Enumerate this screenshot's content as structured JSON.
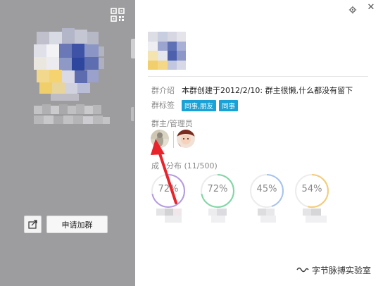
{
  "left_panel": {
    "apply_label": "申请加群"
  },
  "info": {
    "intro_label": "群介绍",
    "intro_text": "本群创建于2012/2/10:  群主很懒,什么都没有留下",
    "tags_label": "群标签",
    "tags": [
      "同事,朋友",
      "同事"
    ]
  },
  "admins": {
    "title": "群主/管理员"
  },
  "members": {
    "title_prefix": "成",
    "title_suffix": "分布",
    "title_count": "(11/500)",
    "stats": [
      {
        "label": "72%",
        "percent": 72,
        "color": "#b49be0"
      },
      {
        "label": "72%",
        "percent": 72,
        "color": "#7fd6a4"
      },
      {
        "label": "45%",
        "percent": 45,
        "color": "#a6c3ef"
      },
      {
        "label": "54%",
        "percent": 54,
        "color": "#f3cd78"
      }
    ]
  },
  "watermark": {
    "text": "字节脉搏实验室"
  },
  "annotation": {
    "arrow_color": "#e8232b"
  }
}
